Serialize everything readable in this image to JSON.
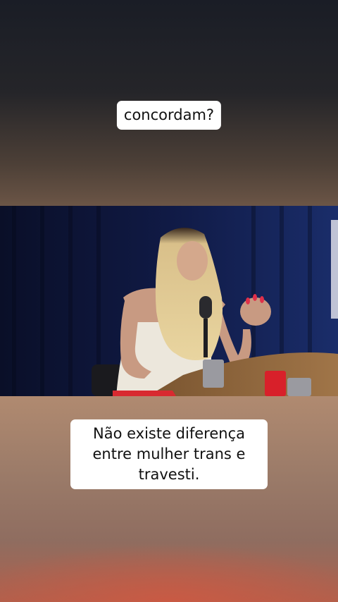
{
  "captions": {
    "top": "concordam?",
    "bottom": "Não existe diferença entre mulher trans e travesti."
  },
  "colors": {
    "caption_bg": "#ffffff",
    "caption_text": "#111111",
    "curtain": "#111a44",
    "table": "#8a6440"
  }
}
